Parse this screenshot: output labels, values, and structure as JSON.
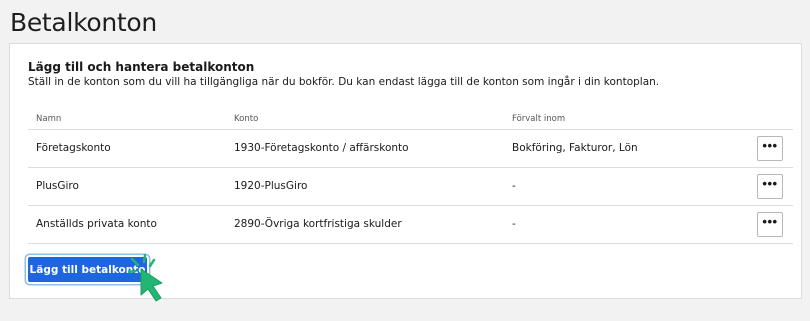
{
  "page": {
    "title": "Betalkonton"
  },
  "card": {
    "heading": "Lägg till och hantera betalkonton",
    "description": "Ställ in de konton som du vill ha tillgängliga när du bokför. Du kan endast lägga till de konton som ingår i din kontoplan."
  },
  "table": {
    "headers": {
      "name": "Namn",
      "account": "Konto",
      "default": "Förvalt inom"
    },
    "rows": [
      {
        "name": "Företagskonto",
        "account": "1930-Företagskonto / affärskonto",
        "default": "Bokföring, Fakturor, Lön",
        "more": "•••"
      },
      {
        "name": "PlusGiro",
        "account": "1920-PlusGiro",
        "default": "-",
        "more": "•••"
      },
      {
        "name": "Anställds privata konto",
        "account": "2890-Övriga kortfristiga skulder",
        "default": "-",
        "more": "•••"
      }
    ]
  },
  "actions": {
    "add_label": "Lägg till betalkonto"
  },
  "icons": {
    "row_menu": "more-horizontal-icon",
    "pointer": "pointer-cursor-icon"
  },
  "colors": {
    "primary": "#1d66e0",
    "cursor": "#22b573"
  }
}
